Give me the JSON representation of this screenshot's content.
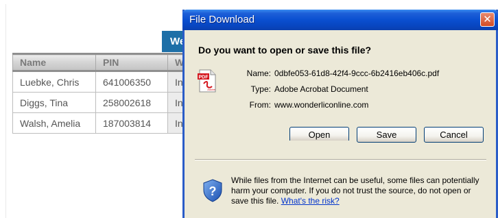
{
  "background_page": {
    "header_tab_label": "Wel",
    "table": {
      "columns": [
        "Name",
        "PIN",
        "Wel"
      ],
      "rows": [
        {
          "name": "Luebke, Chris",
          "pin": "641006350",
          "status": "Ini"
        },
        {
          "name": "Diggs, Tina",
          "pin": "258002618",
          "status": "Ini"
        },
        {
          "name": "Walsh, Amelia",
          "pin": "187003814",
          "status": "Ini"
        }
      ]
    }
  },
  "dialog": {
    "title": "File Download",
    "close_glyph": "✕",
    "question": "Do you want to open or save this file?",
    "file_icon": "pdf-file-icon",
    "pdf_badge": "PDF",
    "adobe_badge": "Adobe",
    "fields": {
      "name_label": "Name:",
      "name_value": "0dbfe053-61d8-42f4-9ccc-6b2416eb406c.pdf",
      "type_label": "Type:",
      "type_value": "Adobe Acrobat Document",
      "from_label": "From:",
      "from_value": "www.wonderliconline.com"
    },
    "buttons": {
      "open": "Open",
      "save": "Save",
      "cancel": "Cancel"
    },
    "warning_icon": "security-shield-question-icon",
    "warning_text": "While files from the Internet can be useful, some files can potentially harm your computer. If you do not trust the source, do not open or save this file.",
    "risk_link": "What's the risk?"
  },
  "colors": {
    "title_bar": "#0a4fd0",
    "dialog_face": "#ece9d8",
    "header_blue": "#1d6fa7",
    "link": "#0033cc"
  }
}
